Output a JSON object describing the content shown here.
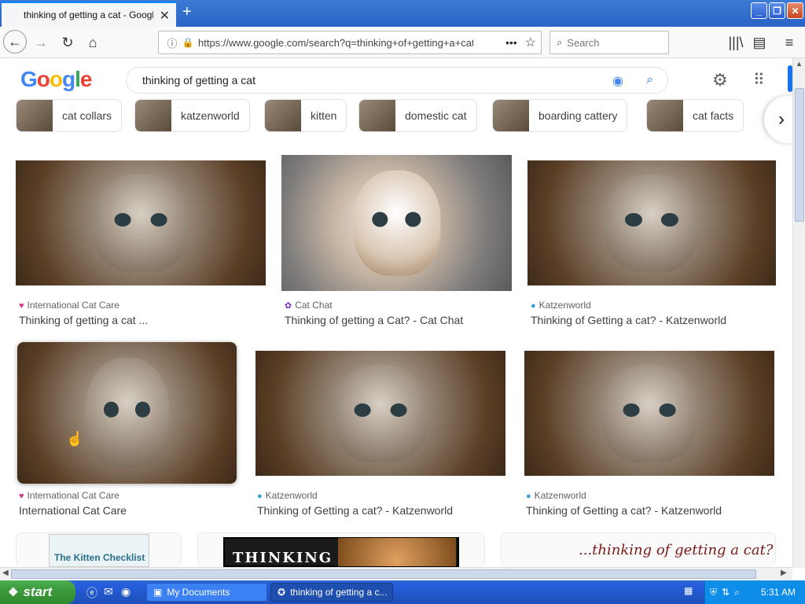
{
  "browser": {
    "tab_title": "thinking of getting a cat - Google Search",
    "url": "https://www.google.com/search?q=thinking+of+getting+a+cat",
    "search_placeholder": "Search",
    "new_tab": "+",
    "close_tab": "✕"
  },
  "google": {
    "logo_letters": [
      "G",
      "o",
      "o",
      "g",
      "l",
      "e"
    ],
    "logo_colors": [
      "#4285f4",
      "#ea4335",
      "#fbbc05",
      "#4285f4",
      "#34a853",
      "#ea4335"
    ],
    "query": "thinking of getting a cat"
  },
  "chips": [
    {
      "label": "cat collars"
    },
    {
      "label": "katzenworld"
    },
    {
      "label": "kitten"
    },
    {
      "label": "domestic cat"
    },
    {
      "label": "boarding cattery"
    },
    {
      "label": "cat facts"
    }
  ],
  "results": [
    {
      "source": "International Cat Care",
      "title": "Thinking of getting a cat ..."
    },
    {
      "source": "Cat Chat",
      "title": "Thinking of getting a Cat? - Cat Chat"
    },
    {
      "source": "Katzenworld",
      "title": "Thinking of Getting a cat? - Katzenworld"
    },
    {
      "source": "International Cat Care",
      "title": "International Cat Care"
    },
    {
      "source": "Katzenworld",
      "title": "Thinking of Getting a cat? - Katzenworld"
    },
    {
      "source": "Katzenworld",
      "title": "Thinking of Getting a cat? - Katzenworld"
    }
  ],
  "bottom_row": {
    "checklist": "The Kitten Checklist",
    "thinking": "THINKING",
    "italic_caption": "...thinking of getting a cat?"
  },
  "taskbar": {
    "start": "start",
    "tasks": [
      "My Documents",
      "thinking of getting a c..."
    ],
    "clock": "5:31 AM"
  }
}
